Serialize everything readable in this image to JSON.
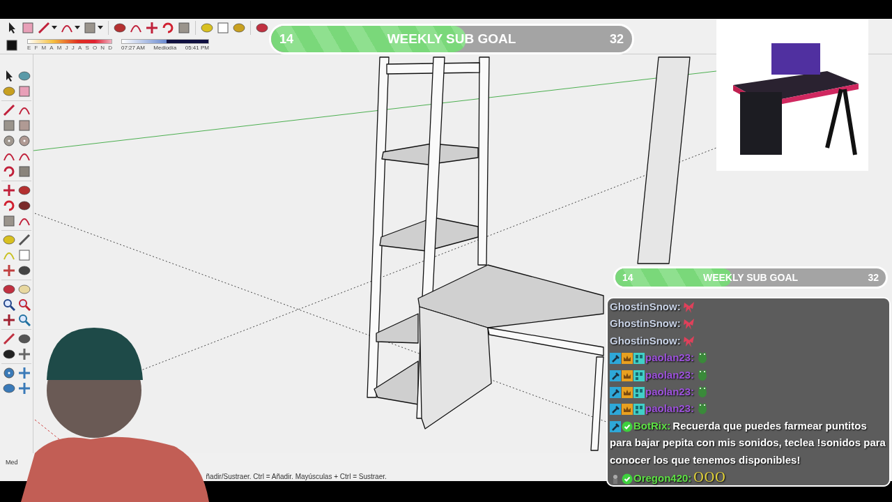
{
  "toolbar": {
    "months": [
      "E",
      "F",
      "M",
      "A",
      "M",
      "J",
      "J",
      "A",
      "S",
      "O",
      "N",
      "D"
    ],
    "shadow_time": {
      "start": "07:27 AM",
      "middle": "Mediodía",
      "end": "05:41 PM",
      "level": 0.52
    }
  },
  "sub_goals": [
    {
      "start": "14",
      "title": "WEEKLY SUB GOAL",
      "end": "32",
      "level": 0.54
    },
    {
      "start": "14",
      "title": "WEEKLY SUB GOAL",
      "end": "32",
      "level": 0.43
    }
  ],
  "chat": {
    "messages": [
      {
        "kind": "bow",
        "user": "GhostinSnow:",
        "color": "#c9d3e6"
      },
      {
        "kind": "bow",
        "user": "GhostinSnow:",
        "color": "#c9d3e6"
      },
      {
        "kind": "bow",
        "user": "GhostinSnow:",
        "color": "#c9d3e6"
      },
      {
        "kind": "frog",
        "user": "paolan23:",
        "color": "#9d52dc"
      },
      {
        "kind": "frog",
        "user": "paolan23:",
        "color": "#9d52dc"
      },
      {
        "kind": "frog",
        "user": "paolan23:",
        "color": "#9d52dc"
      },
      {
        "kind": "frog",
        "user": "paolan23:",
        "color": "#9d52dc"
      },
      {
        "kind": "bot",
        "user": "BotRix:",
        "color": "#5ee045",
        "text": "Recuerda que puedes farmear puntitos para bajar pepita con mis sonidos, teclea !sonidos para conocer los que tenemos disponibles!"
      },
      {
        "kind": "viewer",
        "user": "Oregon420:",
        "color": "#5ee045",
        "text": "OOO"
      }
    ]
  },
  "status_bar": {
    "measure_label": "Med",
    "hint": "ñadir/Sustraer. Ctrl = Añadir. Mayúsculas + Ctrl = Sustraer."
  }
}
